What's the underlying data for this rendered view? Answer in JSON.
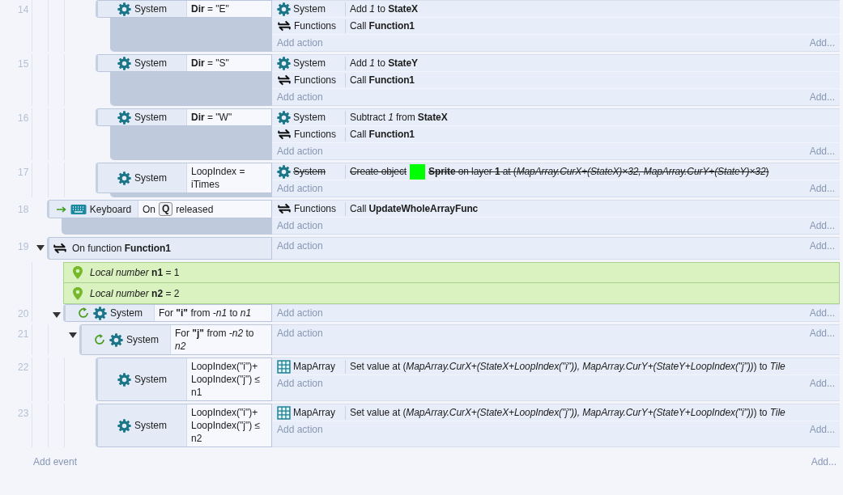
{
  "events": [
    {
      "kind": "group",
      "children": [
        {
          "kind": "group",
          "children": [
            {
              "kind": "group",
              "children": [
                {
                  "kind": "event",
                  "number": "14",
                  "conditions": [
                    {
                      "kind": "system",
                      "object": "System",
                      "text": "**Dir** = \"E\""
                    }
                  ],
                  "actions": [
                    {
                      "kind": "system",
                      "object": "System",
                      "text": "Add *1* to **StateX**",
                      "disabled": false
                    },
                    {
                      "kind": "functions",
                      "object": "Functions",
                      "text": "Call **Function1**",
                      "disabled": false
                    }
                  ],
                  "add_action": "Add action",
                  "add_more": "Add..."
                },
                {
                  "kind": "event",
                  "number": "15",
                  "conditions": [
                    {
                      "kind": "system",
                      "object": "System",
                      "text": "**Dir** = \"S\""
                    }
                  ],
                  "actions": [
                    {
                      "kind": "system",
                      "object": "System",
                      "text": "Add *1* to **StateY**",
                      "disabled": false
                    },
                    {
                      "kind": "functions",
                      "object": "Functions",
                      "text": "Call **Function1**",
                      "disabled": false
                    }
                  ],
                  "add_action": "Add action",
                  "add_more": "Add..."
                },
                {
                  "kind": "event",
                  "number": "16",
                  "conditions": [
                    {
                      "kind": "system",
                      "object": "System",
                      "text": "**Dir** = \"W\""
                    }
                  ],
                  "actions": [
                    {
                      "kind": "system",
                      "object": "System",
                      "text": "Subtract *1* from **StateX**",
                      "disabled": false
                    },
                    {
                      "kind": "functions",
                      "object": "Functions",
                      "text": "Call **Function1**",
                      "disabled": false
                    }
                  ],
                  "add_action": "Add action",
                  "add_more": "Add..."
                },
                {
                  "kind": "event",
                  "number": "17",
                  "conditions": [
                    {
                      "kind": "system",
                      "object": "System",
                      "text": "LoopIndex = iTimes"
                    }
                  ],
                  "actions": [
                    {
                      "kind": "system",
                      "object": "System",
                      "segments": [
                        {
                          "kind": "text",
                          "text": "Create object"
                        },
                        {
                          "kind": "sprite-thumb"
                        },
                        {
                          "kind": "text",
                          "text": "**Sprite** on layer **1** at (*MapArray.CurX+(StateX)×32, MapArray.CurY+(StateY)×32*)"
                        }
                      ],
                      "disabled": true
                    }
                  ],
                  "add_action": "Add action",
                  "add_more": "Add..."
                }
              ]
            }
          ]
        }
      ]
    },
    {
      "kind": "trigger",
      "number": "18",
      "conditions": [
        {
          "kind": "keyboard",
          "object": "Keyboard",
          "segments": [
            {
              "kind": "text",
              "text": "On"
            },
            {
              "kind": "key",
              "text": "Q"
            },
            {
              "kind": "text",
              "text": "released"
            }
          ]
        }
      ],
      "actions": [
        {
          "kind": "functions",
          "object": "Functions",
          "text": "Call **UpdateWholeArrayFunc**",
          "disabled": false
        }
      ],
      "add_action": "Add action",
      "add_more": "Add..."
    },
    {
      "kind": "event",
      "number": "19",
      "expanded": true,
      "conditions": [
        {
          "kind": "function-trigger",
          "text": "On function **Function1**"
        }
      ],
      "add_action": "Add action",
      "add_more": "Add...",
      "children": [
        {
          "kind": "variable",
          "text": "*Local number* **n1** = 1"
        },
        {
          "kind": "variable",
          "text": "*Local number* **n2** = 2"
        },
        {
          "kind": "loop",
          "number": "20",
          "expanded": true,
          "conditions": [
            {
              "kind": "system",
              "object": "System",
              "text": "For **\"i\"** from *-n1* to *n1*"
            }
          ],
          "add_action": "Add action",
          "add_more": "Add...",
          "children": [
            {
              "kind": "loop",
              "number": "21",
              "expanded": true,
              "conditions": [
                {
                  "kind": "system",
                  "object": "System",
                  "text": "For **\"j\"** from *-n2* to *n2*"
                }
              ],
              "add_action": "Add action",
              "add_more": "Add...",
              "children": [
                {
                  "kind": "event",
                  "number": "22",
                  "conditions": [
                    {
                      "kind": "system",
                      "object": "System",
                      "text": "LoopIndex(\"i\")+ LoopIndex(\"j\") ≤ n1"
                    }
                  ],
                  "actions": [
                    {
                      "kind": "array",
                      "object": "MapArray",
                      "text": "Set value at (*MapArray.CurX+(StateX+LoopIndex(\"i\")), MapArray.CurY+(StateY+LoopIndex(\"j\"))*) to *Tile*",
                      "disabled": false
                    }
                  ],
                  "add_action": "Add action",
                  "add_more": "Add..."
                },
                {
                  "kind": "event",
                  "number": "23",
                  "conditions": [
                    {
                      "kind": "system",
                      "object": "System",
                      "text": "LoopIndex(\"i\")+ LoopIndex(\"j\") ≤ n2"
                    }
                  ],
                  "actions": [
                    {
                      "kind": "array",
                      "object": "MapArray",
                      "text": "Set value at (*MapArray.CurX+(StateX+LoopIndex(\"j\")), MapArray.CurY+(StateY+LoopIndex(\"i\"))*) to *Tile*",
                      "disabled": false
                    }
                  ],
                  "add_action": "Add action",
                  "add_more": "Add..."
                }
              ]
            }
          ]
        }
      ]
    }
  ],
  "add_event": "Add event",
  "add_more": "Add..."
}
